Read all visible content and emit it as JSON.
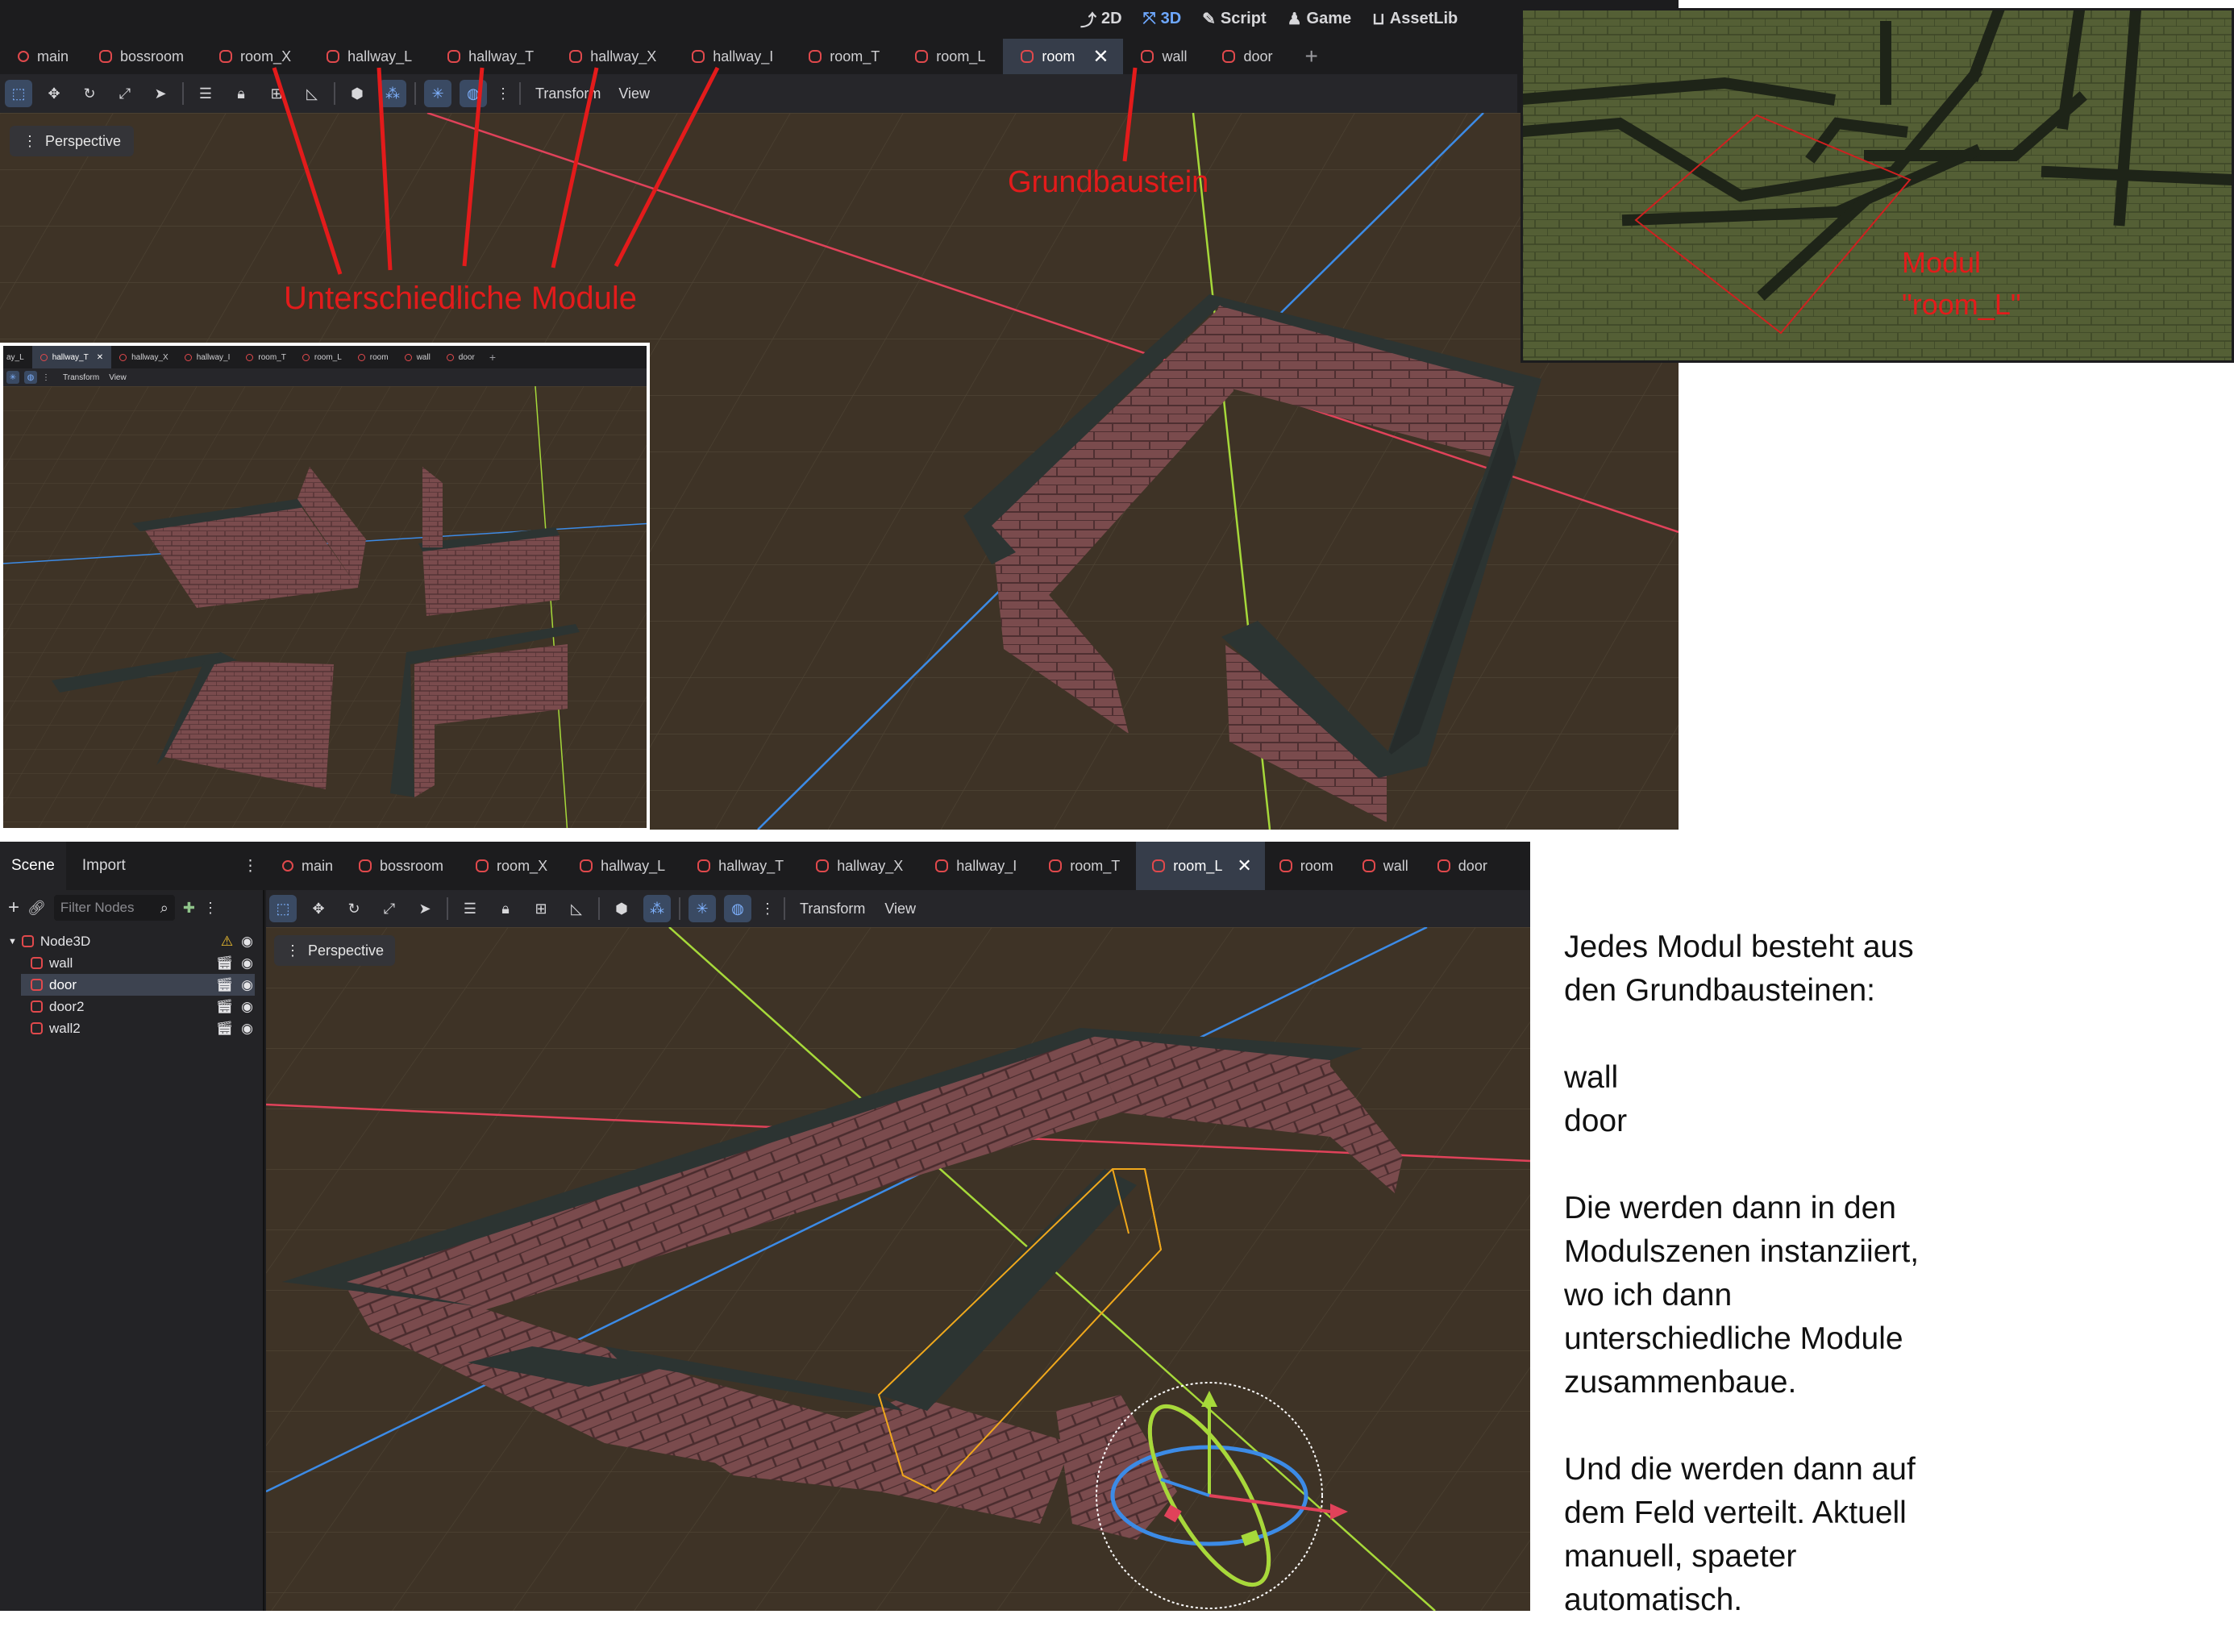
{
  "top_editor": {
    "mode_buttons": [
      {
        "icon": "2d-icon",
        "label": "2D",
        "active": false
      },
      {
        "icon": "3d-icon",
        "label": "3D",
        "active": true
      },
      {
        "icon": "script-icon",
        "label": "Script",
        "active": false
      },
      {
        "icon": "game-icon",
        "label": "Game",
        "active": false
      },
      {
        "icon": "assetlib-icon",
        "label": "AssetLib",
        "active": false
      }
    ],
    "tabs": [
      "main",
      "bossroom",
      "room_X",
      "hallway_L",
      "hallway_T",
      "hallway_X",
      "hallway_I",
      "room_T",
      "room_L",
      "room",
      "wall",
      "door"
    ],
    "active_tab": "room",
    "toolbar": {
      "transform": "Transform",
      "view": "View"
    },
    "perspective_label": "Perspective"
  },
  "annotations": {
    "modules_label": "Unterschiedliche Module",
    "base_label": "Grundbaustein",
    "modul_line1": "Modul",
    "modul_line2": "\"room_L\""
  },
  "inset_editor": {
    "tabs": [
      "ay_L",
      "hallway_T",
      "hallway_X",
      "hallway_I",
      "room_T",
      "room_L",
      "room",
      "wall",
      "door"
    ],
    "active_tab": "hallway_X",
    "toolbar": {
      "transform": "Transform",
      "view": "View"
    }
  },
  "bottom_editor": {
    "dock_tabs": [
      "Scene",
      "Import"
    ],
    "filter_placeholder": "Filter Nodes",
    "tree": [
      {
        "name": "Node3D",
        "depth": 0,
        "warning": true,
        "selected": false
      },
      {
        "name": "wall",
        "depth": 1,
        "warning": false,
        "selected": false
      },
      {
        "name": "door",
        "depth": 1,
        "warning": false,
        "selected": true
      },
      {
        "name": "door2",
        "depth": 1,
        "warning": false,
        "selected": false
      },
      {
        "name": "wall2",
        "depth": 1,
        "warning": false,
        "selected": false
      }
    ],
    "tabs": [
      "main",
      "bossroom",
      "room_X",
      "hallway_L",
      "hallway_T",
      "hallway_X",
      "hallway_I",
      "room_T",
      "room_L",
      "room",
      "wall",
      "door"
    ],
    "active_tab": "room_L",
    "toolbar": {
      "transform": "Transform",
      "view": "View"
    },
    "perspective_label": "Perspective"
  },
  "notes": {
    "p1_l1": "Jedes Modul besteht aus",
    "p1_l2": "den Grundbausteinen:",
    "p2_l1": "wall",
    "p2_l2": "door",
    "p3_l1": "Die werden dann in den",
    "p3_l2": "Modulszenen instanziiert,",
    "p3_l3": "wo ich dann",
    "p3_l4": "unterschiedliche Module",
    "p3_l5": "zusammenbaue.",
    "p4_l1": "Und die werden dann auf",
    "p4_l2": "dem Feld verteilt. Aktuell",
    "p4_l3": "manuell, spaeter",
    "p4_l4": "automatisch."
  },
  "colors": {
    "editor_bg": "#1c1c1e",
    "toolbar_bg": "#26262a",
    "viewport_bg": "#3e3326",
    "brick": "#7a4b4d",
    "wall_top": "#2c3432",
    "annotation_red": "#e31b1b",
    "axis_x": "#e0425a",
    "axis_y": "#a6d93a",
    "axis_z": "#3c8be6"
  }
}
